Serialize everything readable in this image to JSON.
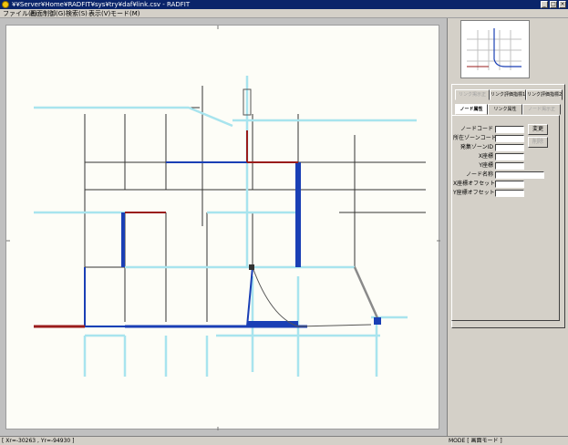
{
  "window": {
    "title": "¥¥Server¥Home¥RADFIT¥sys¥try¥daf¥link.csv - RADFIT",
    "minimize": "_",
    "maximize": "□",
    "close": "×"
  },
  "menu": [
    {
      "label": "ファイル(F)"
    },
    {
      "label": "画面制御(G)"
    },
    {
      "label": "検索(S)"
    },
    {
      "label": "表示(V)"
    },
    {
      "label": "モード(M)"
    }
  ],
  "panel": {
    "tabs_top": [
      {
        "label": "リンク掲示正",
        "state": "disabled"
      },
      {
        "label": "リンク評価指標1",
        "state": "normal"
      },
      {
        "label": "リンク評価指標2",
        "state": "normal"
      }
    ],
    "tabs_bottom": [
      {
        "label": "ノード属性",
        "state": "active"
      },
      {
        "label": "リンク属性",
        "state": "normal"
      },
      {
        "label": "ノード掲示正",
        "state": "disabled"
      }
    ],
    "fields": [
      {
        "label": "ノードコード"
      },
      {
        "label": "所在ゾーンコード"
      },
      {
        "label": "発集ゾーンID"
      },
      {
        "label": "X座標"
      },
      {
        "label": "Y座標"
      },
      {
        "label": "ノード名称"
      },
      {
        "label": "X座標オフセット"
      },
      {
        "label": "Y座標オフセット"
      }
    ],
    "change_button": "変更",
    "delete_button": "削除"
  },
  "status": {
    "coords": "[ Xr=-30263 , Yr=-94930 ]",
    "mode": "MODE [ 画面モード ]"
  },
  "colors": {
    "link_default": "#333333",
    "link_light": "#a8e4ee",
    "link_blue": "#1a3fb5",
    "link_red": "#9a1c1c",
    "link_dark": "#000060"
  }
}
